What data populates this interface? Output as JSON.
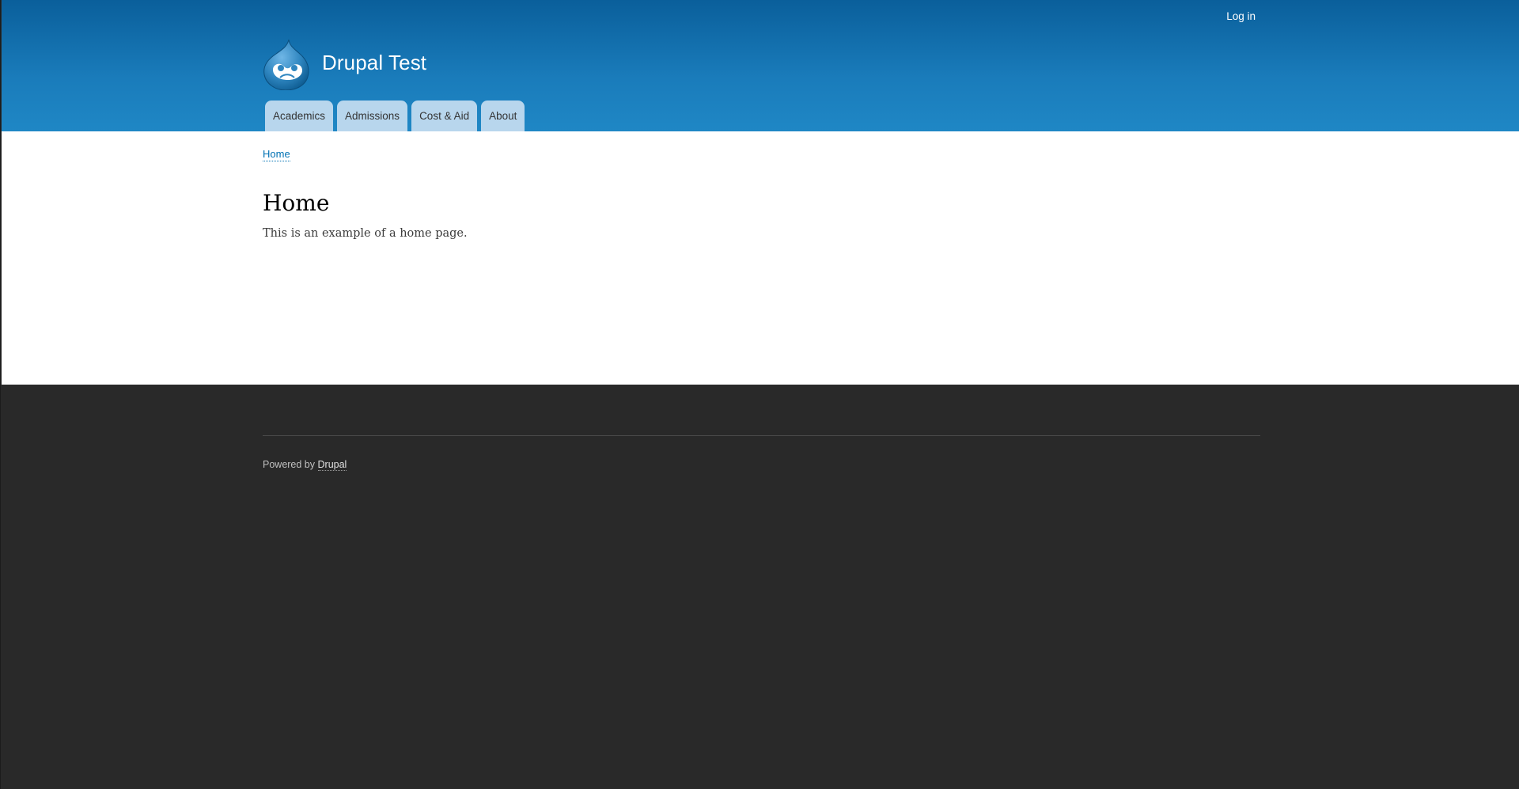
{
  "header": {
    "site_name": "Drupal Test",
    "login_label": "Log in",
    "logo_icon": "drupal-drop-icon",
    "gradient_top": "#0a5f9b",
    "gradient_bottom": "#1f87c5"
  },
  "main_menu": {
    "items": [
      {
        "label": "Academics"
      },
      {
        "label": "Admissions"
      },
      {
        "label": "Cost & Aid"
      },
      {
        "label": "About"
      }
    ],
    "tab_color": "#b8d6ed"
  },
  "breadcrumb": {
    "home_label": "Home"
  },
  "content": {
    "title": "Home",
    "body": "This is an example of a home page."
  },
  "footer": {
    "powered_prefix": "Powered by",
    "powered_link": "Drupal",
    "background": "#292929"
  }
}
